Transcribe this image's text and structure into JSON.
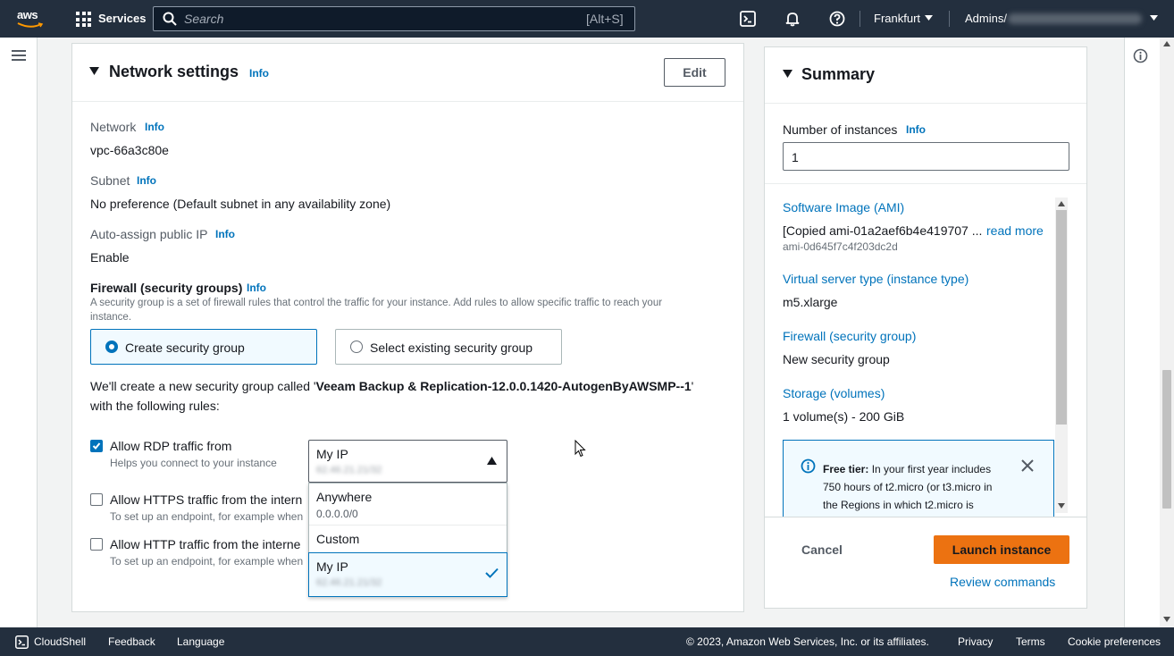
{
  "topbar": {
    "logo": "aws",
    "services_label": "Services",
    "search_placeholder": "Search",
    "search_shortcut": "[Alt+S]",
    "region": "Frankfurt",
    "account": "Admins/"
  },
  "network": {
    "title": "Network settings",
    "title_info": "Info",
    "edit_label": "Edit",
    "network_label": "Network",
    "network_info": "Info",
    "network_value": "vpc-66a3c80e",
    "subnet_label": "Subnet",
    "subnet_info": "Info",
    "subnet_value": "No preference (Default subnet in any availability zone)",
    "public_ip_label": "Auto-assign public IP",
    "public_ip_info": "Info",
    "public_ip_value": "Enable",
    "firewall_label": "Firewall (security groups)",
    "firewall_info": "Info",
    "firewall_desc_1": "A security group is a set of firewall rules that control the traffic for your instance. Add rules to allow specific traffic to reach your",
    "firewall_desc_2": "instance.",
    "option_create": "Create security group",
    "option_existing": "Select existing security group",
    "create_msg_prefix": "We'll create a new security group called '",
    "create_msg_name": "Veeam Backup & Replication-12.0.0.1420-AutogenByAWSMP--1",
    "create_msg_suffix": "'",
    "create_msg_line2": "with the following rules:",
    "rules": [
      {
        "label": "Allow RDP traffic from",
        "hint": "Helps you connect to your instance",
        "checked": true
      },
      {
        "label": "Allow HTTPS traffic from the intern",
        "hint": "To set up an endpoint, for example when",
        "checked": false
      },
      {
        "label": "Allow HTTP traffic from the interne",
        "hint": "To set up an endpoint, for example when",
        "checked": false
      }
    ],
    "dropdown": {
      "selected": "My IP",
      "selected_sub": "62.46.21.21/32",
      "options": [
        {
          "label": "Anywhere",
          "sub": "0.0.0.0/0"
        },
        {
          "label": "Custom",
          "sub": ""
        },
        {
          "label": "My IP",
          "sub": "62.46.21.21/32"
        }
      ]
    }
  },
  "summary": {
    "title": "Summary",
    "instances_label": "Number of instances",
    "instances_info": "Info",
    "instances_value": "1",
    "ami_label": "Software Image (AMI)",
    "ami_value": "[Copied ami-01a2aef6b4e419707 ...",
    "ami_read_more": "read more",
    "ami_id": "ami-0d645f7c4f203dc2d",
    "type_label": "Virtual server type (instance type)",
    "type_value": "m5.xlarge",
    "firewall_label": "Firewall (security group)",
    "firewall_value": "New security group",
    "storage_label": "Storage (volumes)",
    "storage_value": "1 volume(s) - 200 GiB",
    "free_tier_bold": "Free tier:",
    "free_tier_l1": " In your first year includes",
    "free_tier_l2": "750 hours of t2.micro (or t3.micro in",
    "free_tier_l3": "the Regions in which t2.micro is",
    "cancel_label": "Cancel",
    "launch_label": "Launch instance",
    "review_label": "Review commands"
  },
  "footer": {
    "cloudshell": "CloudShell",
    "feedback": "Feedback",
    "language": "Language",
    "copyright": "© 2023, Amazon Web Services, Inc. or its affiliates.",
    "privacy": "Privacy",
    "terms": "Terms",
    "cookies": "Cookie preferences"
  },
  "colors": {
    "topbar": "#232f3e",
    "link": "#0073bb",
    "primary_button": "#ec7211"
  }
}
